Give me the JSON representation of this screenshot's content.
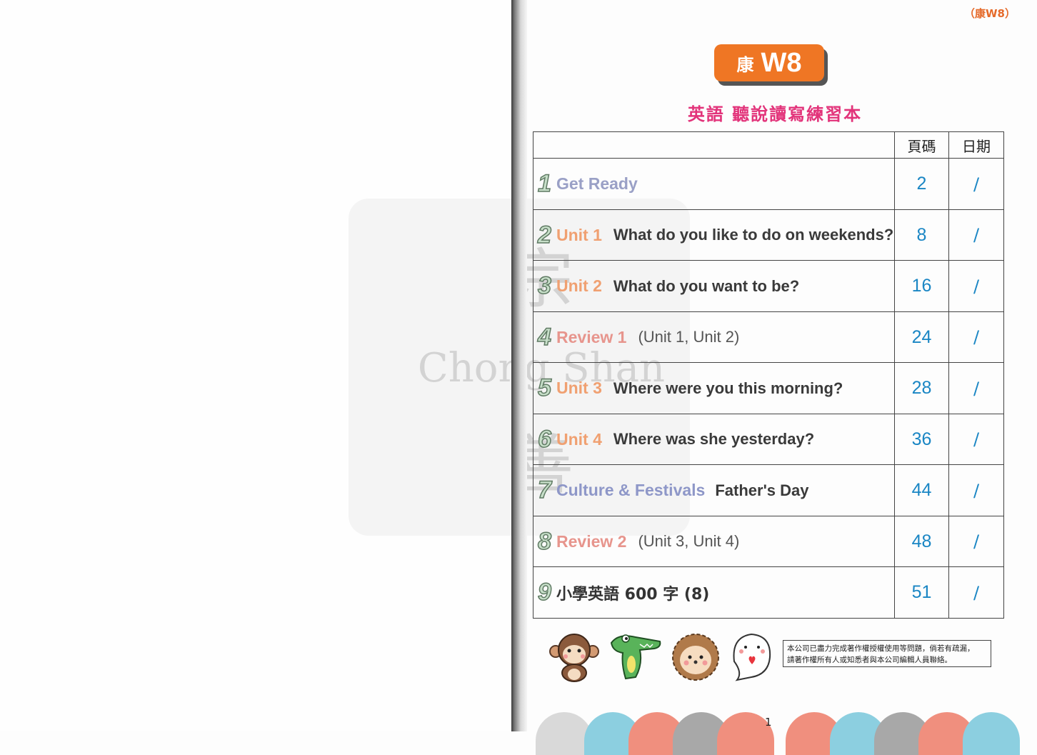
{
  "corner_code": "（康W8）",
  "badge": {
    "prefix": "康",
    "code": "W8"
  },
  "subtitle": "英語 聽說讀寫練習本",
  "watermark": {
    "line1": "宗",
    "line2": "Chong Shan",
    "line3": "善"
  },
  "table": {
    "headers": {
      "page": "頁碼",
      "date": "日期"
    },
    "rows": [
      {
        "num": "1",
        "label": "Get Ready",
        "desc": "",
        "page": "2",
        "date": "/"
      },
      {
        "num": "2",
        "label": "Unit 1",
        "desc": "What do you like to do on weekends?",
        "page": "8",
        "date": "/"
      },
      {
        "num": "3",
        "label": "Unit 2",
        "desc": "What do you want to be?",
        "page": "16",
        "date": "/"
      },
      {
        "num": "4",
        "label": "Review 1",
        "desc": "(Unit 1, Unit 2)",
        "page": "24",
        "date": "/"
      },
      {
        "num": "5",
        "label": "Unit 3",
        "desc": "Where were you this morning?",
        "page": "28",
        "date": "/"
      },
      {
        "num": "6",
        "label": "Unit 4",
        "desc": "Where was she yesterday?",
        "page": "36",
        "date": "/"
      },
      {
        "num": "7",
        "label": "Culture & Festivals",
        "desc": "Father's Day",
        "page": "44",
        "date": "/"
      },
      {
        "num": "8",
        "label": "Review 2",
        "desc": "(Unit 3, Unit 4)",
        "page": "48",
        "date": "/"
      },
      {
        "num": "9",
        "label": "小學英語 600 字 (8)",
        "desc": "",
        "page": "51",
        "date": "/"
      }
    ]
  },
  "notice": {
    "line1": "本公司已盡力完成著作權授權使用等問題，倘若有疏漏，",
    "line2": "請著作權所有人或知悉者與本公司編輯人員聯絡。"
  },
  "page_number": "1",
  "colors": {
    "accent": "#ef7624",
    "subtitle": "#e2337a",
    "page_numbers": "#1a86c4"
  },
  "icons": [
    "monkey-icon",
    "crocodile-icon",
    "hedgehog-icon",
    "seal-icon"
  ]
}
